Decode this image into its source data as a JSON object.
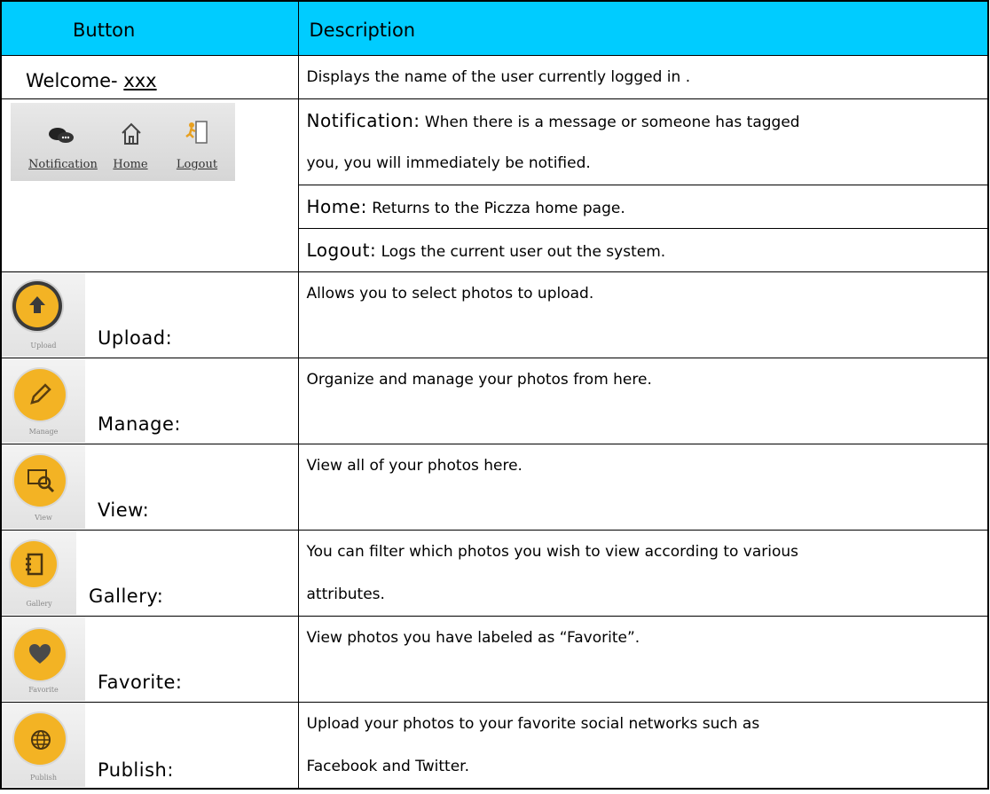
{
  "header": {
    "button": "Button",
    "description": "Description"
  },
  "welcome": {
    "prefix": "Welcome-",
    "user": "xxx",
    "description": "Displays the name of the user currently logged in ."
  },
  "toolbar": {
    "items": [
      {
        "label": "Notification",
        "icon": "chat-bubbles-icon"
      },
      {
        "label": "Home",
        "icon": "house-icon"
      },
      {
        "label": "Logout",
        "icon": "door-exit-icon"
      }
    ],
    "notification_desc": {
      "title": "Notification:",
      "line1": " When there is a message or someone has tagged",
      "line2": "you, you will immediately be notified."
    },
    "home_desc": {
      "title": "Home:",
      "text": " Returns to the Piczza home page."
    },
    "logout_desc": {
      "title": "Logout:",
      "text": " Logs the current user out the system."
    }
  },
  "buttons": [
    {
      "name": "Upload:",
      "icon_label": "Upload",
      "icon": "upload-arrow-icon",
      "line1": "Allows you to select photos to upload.",
      "line2": ""
    },
    {
      "name": "Manage:",
      "icon_label": "Manage",
      "icon": "pencil-icon",
      "line1": "Organize and manage your photos from here.",
      "line2": ""
    },
    {
      "name": "View:",
      "icon_label": "View",
      "icon": "photo-search-icon",
      "line1": "View all of your photos here.",
      "line2": ""
    },
    {
      "name": "Gallery:",
      "icon_label": "Gallery",
      "icon": "album-icon",
      "line1": "You can filter which photos you wish to view according to various",
      "line2": "attributes."
    },
    {
      "name": "Favorite:",
      "icon_label": "Favorite",
      "icon": "heart-icon",
      "line1": "View photos you have labeled as “Favorite”.",
      "line2": ""
    },
    {
      "name": "Publish:",
      "icon_label": "Publish",
      "icon": "globe-icon",
      "line1": "Upload your photos to your favorite social networks such as",
      "line2": "Facebook and Twitter."
    }
  ],
  "colors": {
    "header_bg": "#00ccff",
    "icon_accent": "#f3b324"
  }
}
